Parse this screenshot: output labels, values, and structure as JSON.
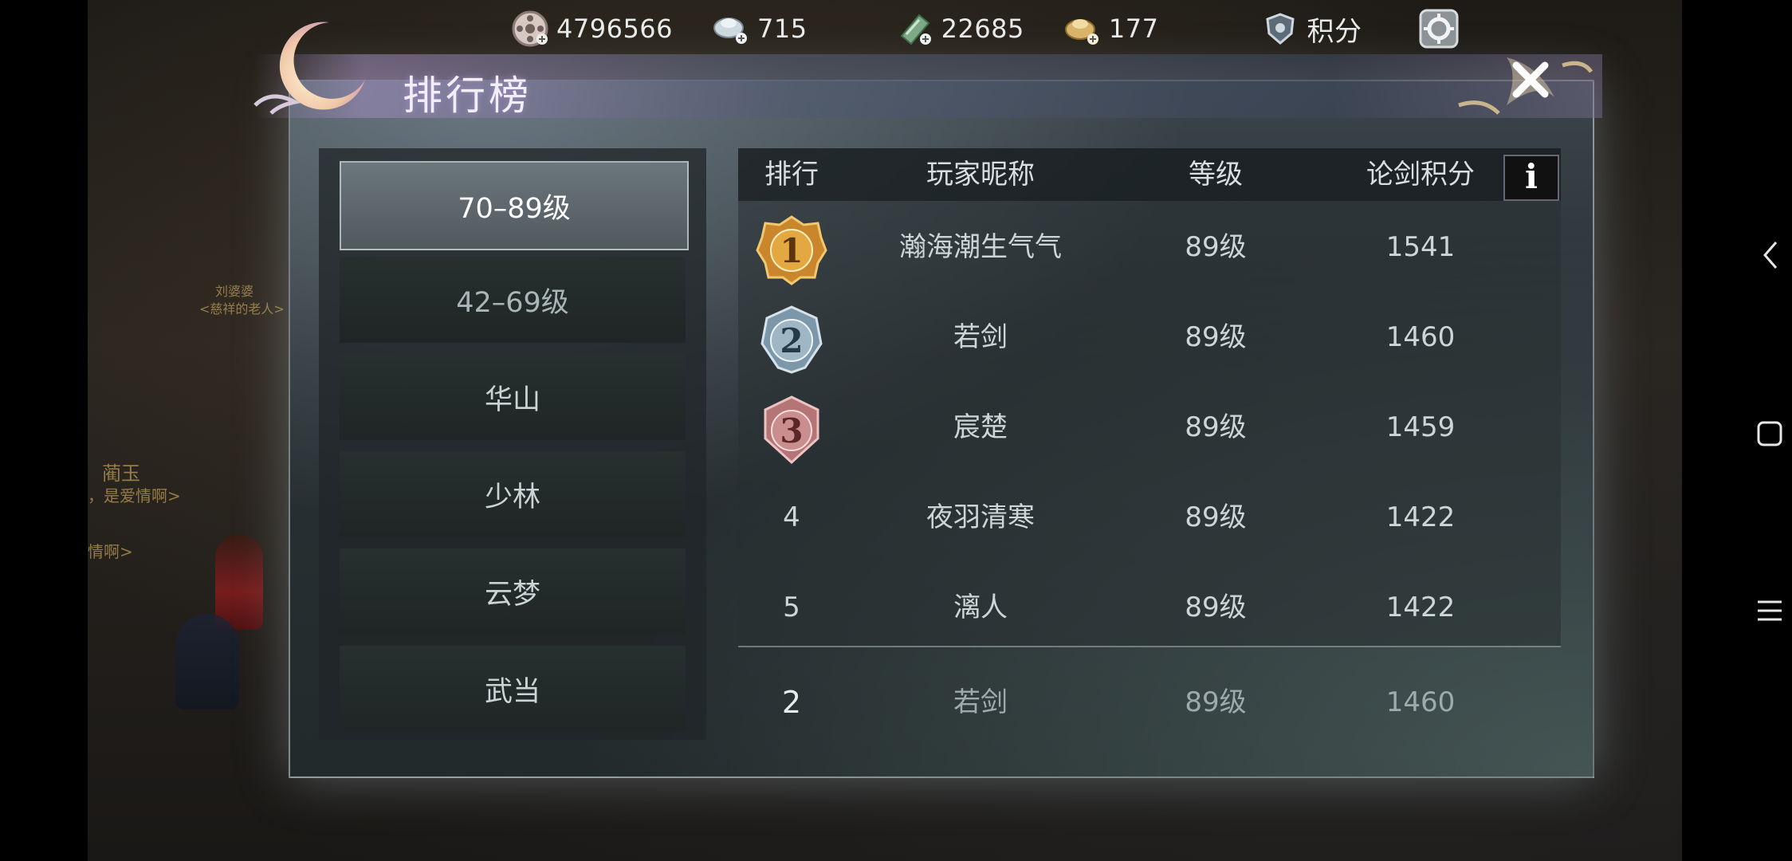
{
  "resources": [
    {
      "icon": "coin-film-icon",
      "value": "4796566"
    },
    {
      "icon": "silver-ingot-add-icon",
      "value": "715"
    },
    {
      "icon": "jade-add-icon",
      "value": "22685"
    },
    {
      "icon": "gold-ingot-add-icon",
      "value": "177"
    }
  ],
  "points_label": "积分",
  "title": "排行榜",
  "background_text": {
    "npc_name": "刘婆婆",
    "npc_title": "<慈祥的老人>",
    "chat_name": "蔺玉",
    "chat_line1": "，是爱情啊>",
    "chat_line2": "情啊>"
  },
  "tabs": [
    {
      "label": "70–89级",
      "active": true
    },
    {
      "label": "42–69级",
      "active": false
    },
    {
      "label": "华山",
      "active": false
    },
    {
      "label": "少林",
      "active": false
    },
    {
      "label": "云梦",
      "active": false
    },
    {
      "label": "武当",
      "active": false
    }
  ],
  "table": {
    "headers": {
      "rank": "排行",
      "name": "玩家昵称",
      "level": "等级",
      "score": "论剑积分"
    },
    "info_label": "i",
    "rows": [
      {
        "rank": "1",
        "name": "瀚海潮生气气",
        "level": "89级",
        "score": "1541"
      },
      {
        "rank": "2",
        "name": "若剑",
        "level": "89级",
        "score": "1460"
      },
      {
        "rank": "3",
        "name": "宸楚",
        "level": "89级",
        "score": "1459"
      },
      {
        "rank": "4",
        "name": "夜羽清寒",
        "level": "89级",
        "score": "1422"
      },
      {
        "rank": "5",
        "name": "漓人",
        "level": "89级",
        "score": "1422"
      }
    ],
    "self": {
      "rank": "2",
      "name": "若剑",
      "level": "89级",
      "score": "1460"
    }
  },
  "colors": {
    "gold_medal": "#c9862c",
    "silver_medal": "#7d97aa",
    "bronze_medal": "#b57576",
    "panel_bg": "#2a3135"
  }
}
